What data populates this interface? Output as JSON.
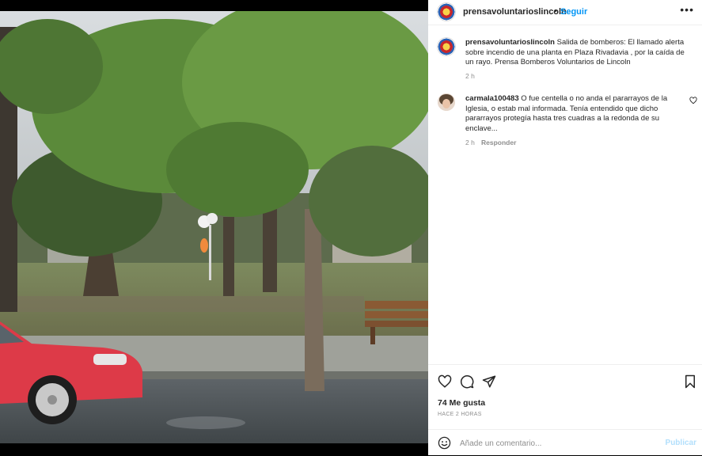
{
  "post": {
    "username": "prensavoluntarioslincoln",
    "follow_label": "Seguir",
    "more_icon": "more-options-icon",
    "caption_text": "Salida de bomberos: El llamado alerta sobre incendio de una planta en Plaza Rivadavia , por la caída de un rayo. Prensa Bomberos Voluntarios de Lincoln",
    "caption_time": "2 h",
    "likes": "74 Me gusta",
    "posted_ago": "HACE 2 HORAS"
  },
  "comments": [
    {
      "username": "carmala100483",
      "text": "O fue centella o no anda el pararrayos de la Iglesia, o estab mal informada. Tenía entendido que dicho pararrayos protegía hasta tres cuadras a la redonda de su enclave...",
      "time": "2 h",
      "reply_label": "Responder"
    }
  ],
  "actions": {
    "like_icon": "heart-icon",
    "comment_icon": "comment-icon",
    "share_icon": "share-icon",
    "save_icon": "bookmark-icon"
  },
  "comment_box": {
    "placeholder": "Añade un comentario...",
    "publish_label": "Publicar"
  },
  "colors": {
    "accent": "#0095f6",
    "publish_disabled": "#b2dffc",
    "muted_text": "#8e8e8e"
  }
}
